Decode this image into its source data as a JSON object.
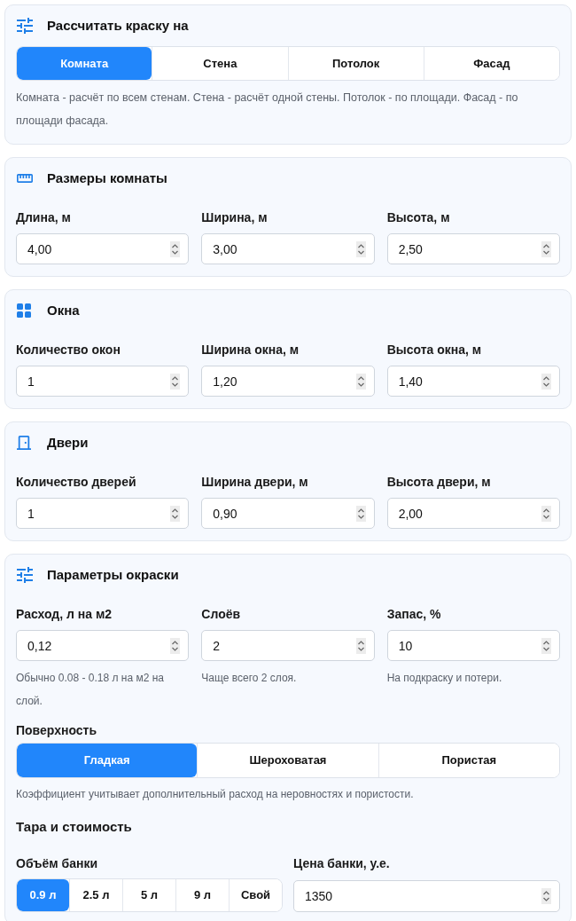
{
  "calc_mode": {
    "title": "Рассчитать краску на",
    "options": [
      {
        "label": "Комната",
        "selected": true
      },
      {
        "label": "Стена",
        "selected": false
      },
      {
        "label": "Потолок",
        "selected": false
      },
      {
        "label": "Фасад",
        "selected": false
      }
    ],
    "hint": "Комната - расчёт по всем стенам. Стена - расчёт одной стены. Потолок - по площади. Фасад - по площади фасада."
  },
  "room_size": {
    "title": "Размеры комнаты",
    "fields": [
      {
        "label": "Длина, м",
        "value": "4,00"
      },
      {
        "label": "Ширина, м",
        "value": "3,00"
      },
      {
        "label": "Высота, м",
        "value": "2,50"
      }
    ]
  },
  "windows": {
    "title": "Окна",
    "fields": [
      {
        "label": "Количество окон",
        "value": "1"
      },
      {
        "label": "Ширина окна, м",
        "value": "1,20"
      },
      {
        "label": "Высота окна, м",
        "value": "1,40"
      }
    ]
  },
  "doors": {
    "title": "Двери",
    "fields": [
      {
        "label": "Количество дверей",
        "value": "1"
      },
      {
        "label": "Ширина двери, м",
        "value": "0,90"
      },
      {
        "label": "Высота двери, м",
        "value": "2,00"
      }
    ]
  },
  "paint_params": {
    "title": "Параметры окраски",
    "fields": [
      {
        "label": "Расход, л на м2",
        "value": "0,12",
        "hint": "Обычно 0.08 - 0.18 л на м2 на слой."
      },
      {
        "label": "Слоёв",
        "value": "2",
        "hint": "Чаще всего 2 слоя."
      },
      {
        "label": "Запас, %",
        "value": "10",
        "hint": "На подкраску и потери."
      }
    ],
    "surface": {
      "label": "Поверхность",
      "options": [
        {
          "label": "Гладкая",
          "selected": true
        },
        {
          "label": "Шероховатая",
          "selected": false
        },
        {
          "label": "Пористая",
          "selected": false
        }
      ],
      "hint": "Коэффициент учитывает дополнительный расход на неровностях и пористости."
    },
    "packaging": {
      "title": "Тара и стоимость",
      "can_volume": {
        "label": "Объём банки",
        "options": [
          {
            "label": "0.9 л",
            "selected": true
          },
          {
            "label": "2.5 л",
            "selected": false
          },
          {
            "label": "5 л",
            "selected": false
          },
          {
            "label": "9 л",
            "selected": false
          },
          {
            "label": "Свой",
            "selected": false
          }
        ]
      },
      "can_price": {
        "label": "Цена банки, у.е.",
        "value": "1350"
      }
    }
  }
}
